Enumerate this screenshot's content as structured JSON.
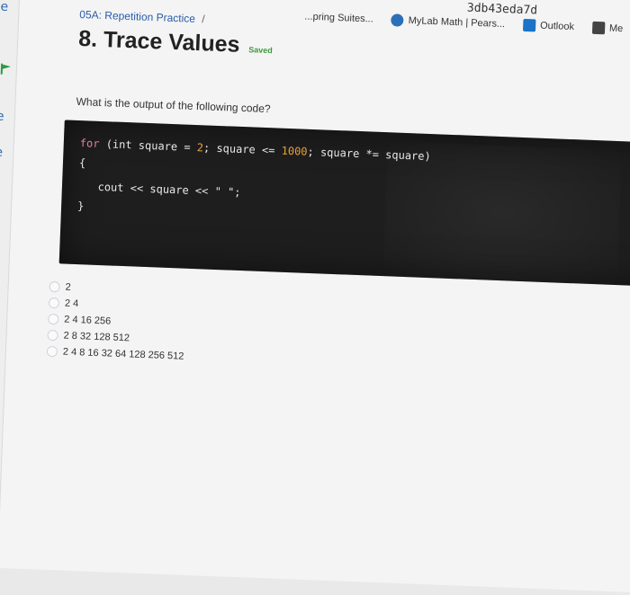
{
  "browser": {
    "hash_text": "3db43eda7d",
    "bookmarks": [
      {
        "label": "...pring Suites...",
        "icon": "bookmark-icon",
        "color": "#999999"
      },
      {
        "label": "MyLab Math | Pears...",
        "icon": "pearson-icon",
        "color": "#2c6fb7"
      },
      {
        "label": "Outlook",
        "icon": "outlook-icon",
        "color": "#1a73c8"
      },
      {
        "label": "Me",
        "icon": "app-icon",
        "color": "#444444"
      }
    ]
  },
  "sidebar": {
    "marks": [
      "e",
      "e",
      "e"
    ]
  },
  "assignment": {
    "breadcrumb": "05A: Repetition Practice",
    "breadcrumb_sep": "/",
    "title": "8. Trace Values",
    "status": "Saved"
  },
  "question": {
    "prompt": "What is the output of the following code?",
    "code_lines": [
      {
        "segments": [
          {
            "text": "for",
            "cls": "kw"
          },
          {
            "text": " (int square = "
          },
          {
            "text": "2",
            "cls": "num"
          },
          {
            "text": "; square <= "
          },
          {
            "text": "1000",
            "cls": "num"
          },
          {
            "text": "; square *= square)"
          }
        ]
      },
      {
        "segments": [
          {
            "text": "{"
          }
        ]
      },
      {
        "segments": [
          {
            "text": "   cout << square << \" \";"
          }
        ]
      },
      {
        "segments": [
          {
            "text": "}"
          }
        ]
      }
    ]
  },
  "options": [
    "2",
    "2 4",
    "2 4 16 256",
    "2 8 32 128 512",
    "2 4 8 16 32 64 128 256 512"
  ],
  "colors": {
    "link": "#2a5da8",
    "saved": "#3b9a3b",
    "code_bg": "#1e1e1f"
  }
}
